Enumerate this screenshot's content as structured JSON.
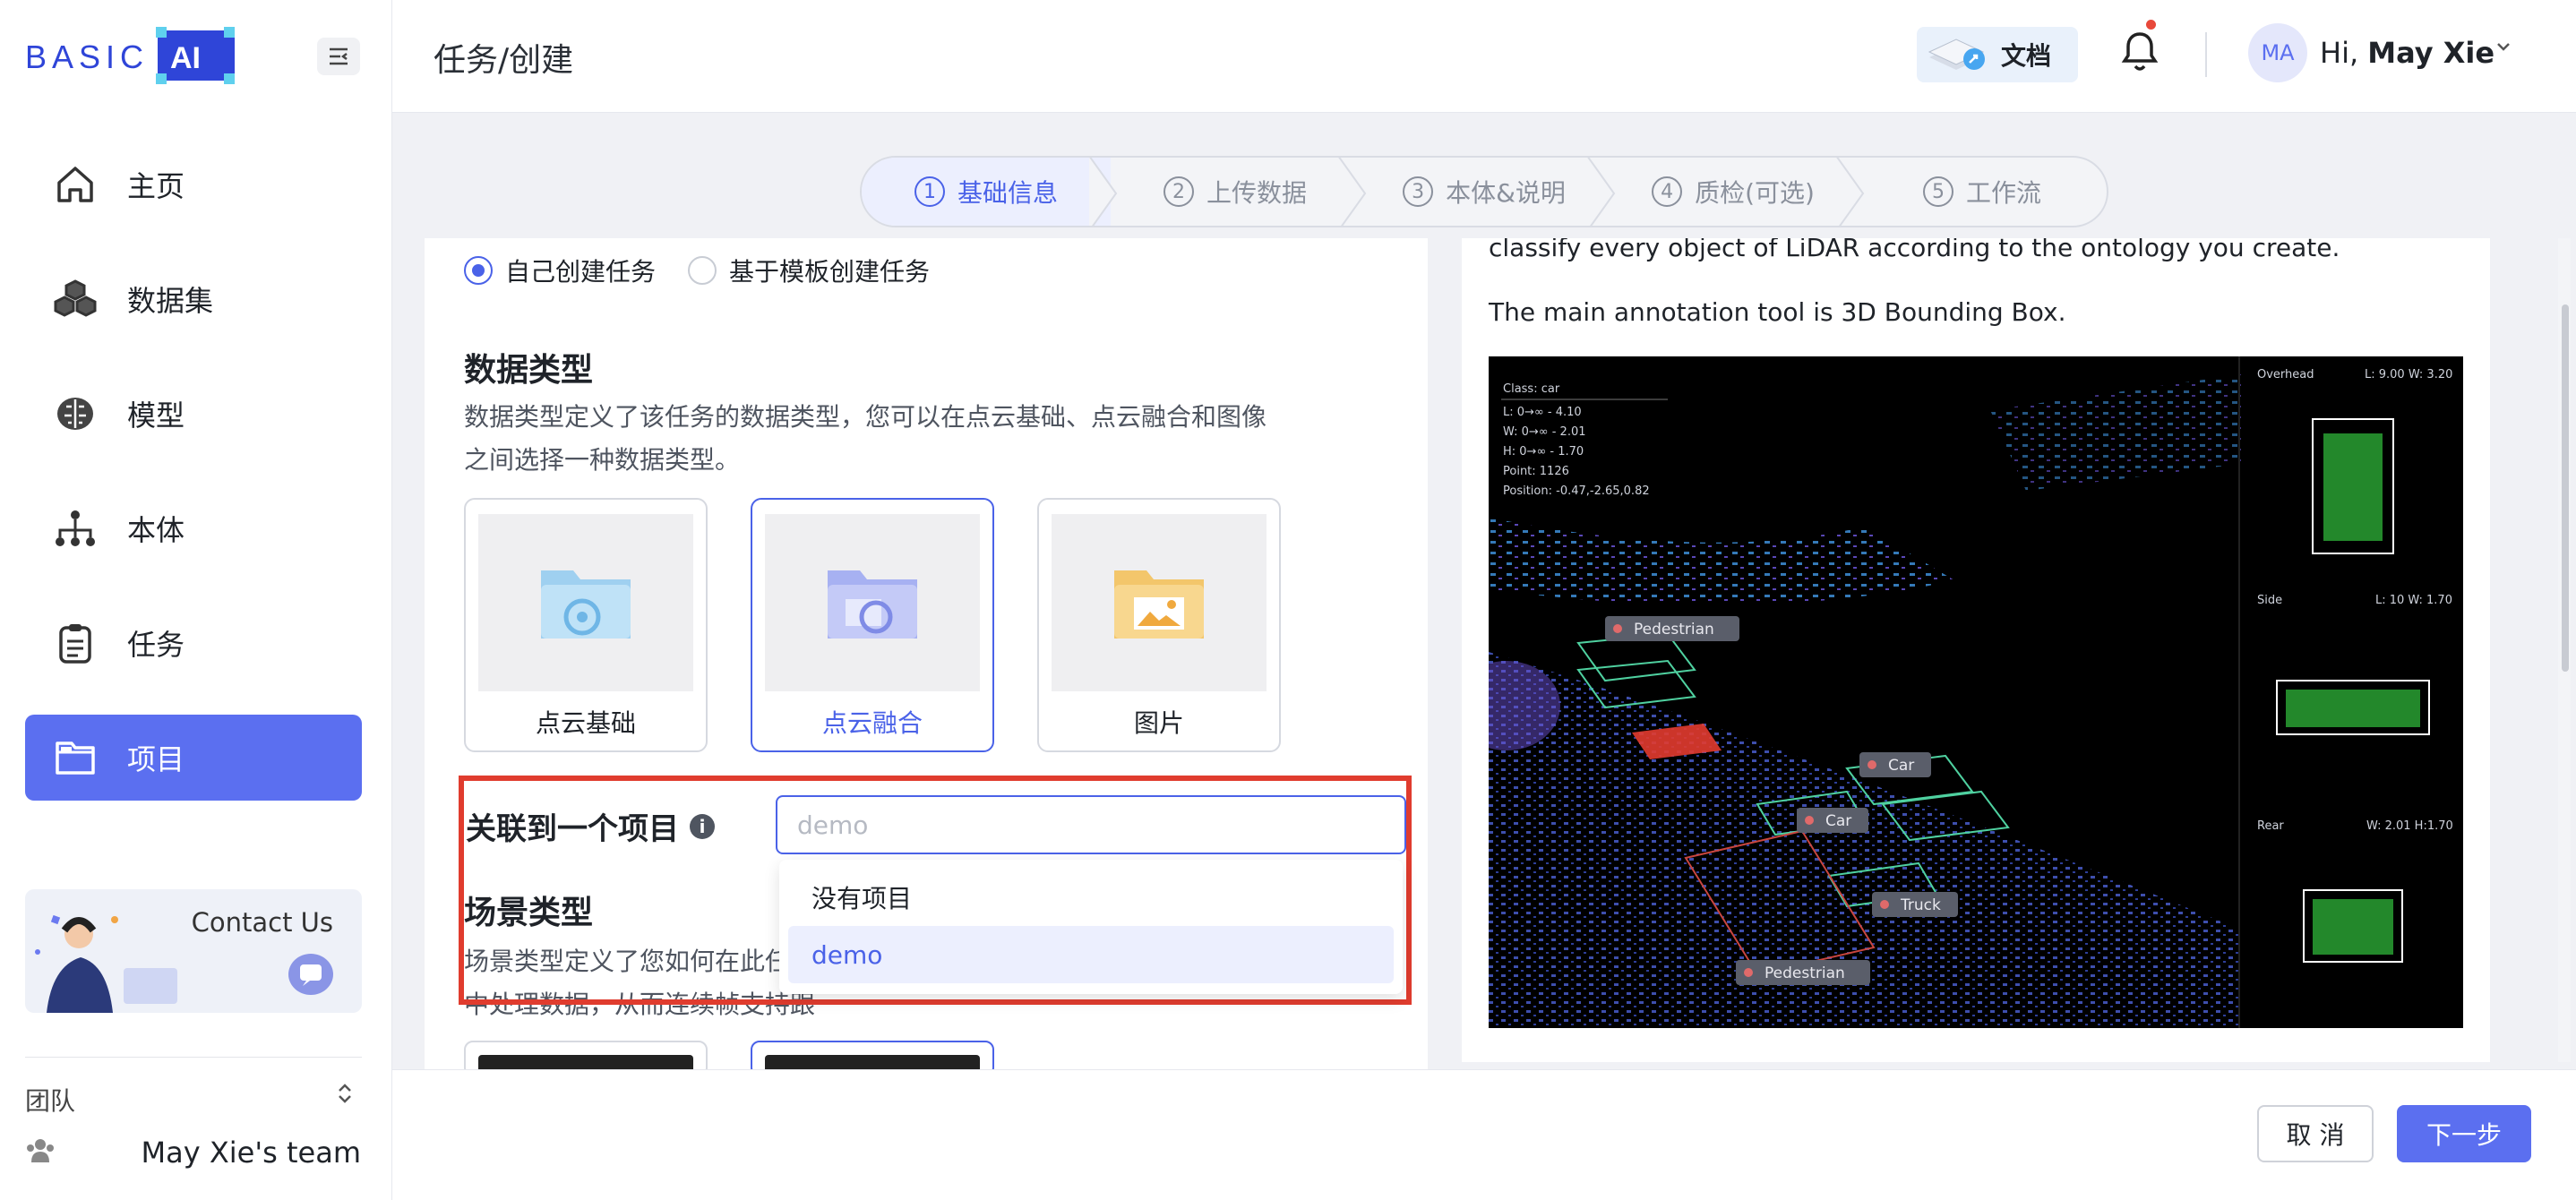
{
  "brand": {
    "logo_text": "BASIC",
    "logo_ai": "AI",
    "accent": "#5b6ff0",
    "highlight": "#e03c2e"
  },
  "sidebar": {
    "items": [
      {
        "label": "主页",
        "icon": "home-icon"
      },
      {
        "label": "数据集",
        "icon": "cubes-icon"
      },
      {
        "label": "模型",
        "icon": "brain-icon"
      },
      {
        "label": "本体",
        "icon": "hierarchy-icon"
      },
      {
        "label": "任务",
        "icon": "clipboard-icon"
      },
      {
        "label": "项目",
        "icon": "folder-icon",
        "active": true
      }
    ],
    "contact": "Contact Us",
    "team_label": "团队",
    "team_toggle": "⌃⌄",
    "team_name": "May Xie's team"
  },
  "header": {
    "breadcrumb": "任务/创建",
    "docs_label": "文档",
    "avatar_initials": "MA",
    "greeting_prefix": "Hi, ",
    "user_name": "May Xie"
  },
  "stepper": {
    "steps": [
      {
        "num": "1",
        "label": "基础信息",
        "active": true
      },
      {
        "num": "2",
        "label": "上传数据"
      },
      {
        "num": "3",
        "label": "本体&说明"
      },
      {
        "num": "4",
        "label": "质检(可选)"
      },
      {
        "num": "5",
        "label": "工作流"
      }
    ]
  },
  "form": {
    "create_options": [
      "自己创建任务",
      "基于模板创建任务"
    ],
    "data_type_title": "数据类型",
    "data_type_desc": "数据类型定义了该任务的数据类型，您可以在点云基础、点云融合和图像之间选择一种数据类型。",
    "data_types": [
      "点云基础",
      "点云融合",
      "图片"
    ],
    "selected_data_type": "点云融合",
    "associate_label": "关联到一个项目",
    "info_glyph": "i",
    "project_placeholder": "demo",
    "project_options": [
      "没有项目",
      "demo"
    ],
    "selected_project": "demo",
    "scene_type_title": "场景类型",
    "scene_type_desc": "场景类型定义了您如何在此任务中处理数据，从而连续帧支持跟踪任务。"
  },
  "preview": {
    "line1": "classify every object of LiDAR according to the ontology you create.",
    "line2": "The main annotation tool is 3D Bounding Box.",
    "overlay": {
      "class_line": "Class: car",
      "l_line": "L: 0→∞ - 4.10",
      "w_line": "W: 0→∞ - 2.01",
      "h_line": "H: 0→∞ - 1.70",
      "point_line": "Point: 1126",
      "position_line": "Position: -0.47,-2.65,0.82",
      "overhead_label": "Overhead",
      "overhead_dims": "L: 9.00 W: 3.20",
      "side_label": "Side",
      "side_dims": "L: 10 W: 1.70",
      "rear_label": "Rear",
      "rear_dims": "W: 2.01 H:1.70",
      "tags": [
        "Pedestrian",
        "Car",
        "Car",
        "Truck",
        "Pedestrian"
      ]
    }
  },
  "footer": {
    "cancel": "取 消",
    "next": "下一步"
  }
}
